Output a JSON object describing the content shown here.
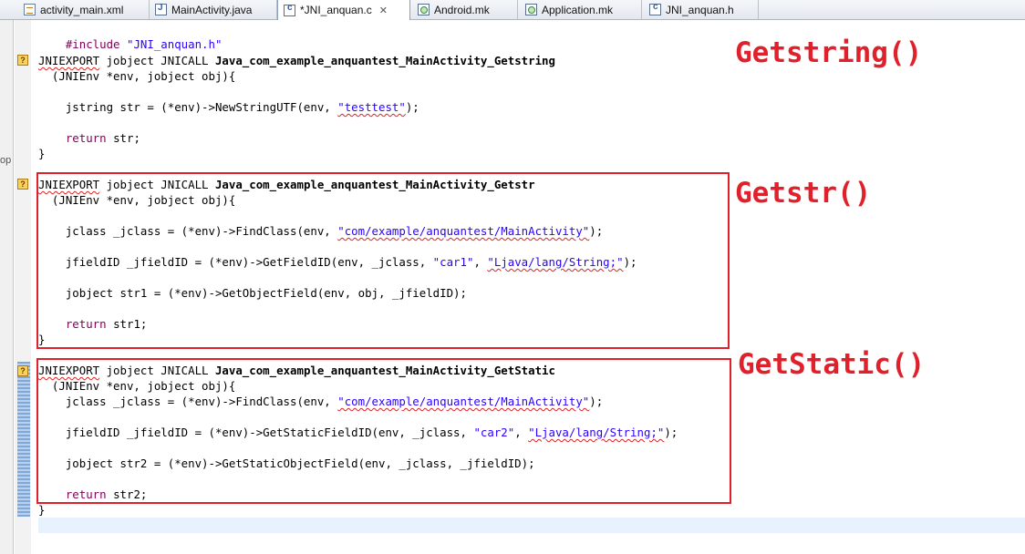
{
  "tabs": [
    {
      "label": "activity_main.xml",
      "icon": "xml-file-icon"
    },
    {
      "label": "MainActivity.java",
      "icon": "java-file-icon"
    },
    {
      "label": "*JNI_anquan.c",
      "icon": "c-file-icon",
      "active": true
    },
    {
      "label": "Android.mk",
      "icon": "mk-file-icon"
    },
    {
      "label": "Application.mk",
      "icon": "mk-file-icon"
    },
    {
      "label": "JNI_anquan.h",
      "icon": "h-file-icon"
    }
  ],
  "tab_close_glyph": "✕",
  "edge_text": "op",
  "warning_glyph": "?",
  "code": {
    "include": {
      "directive": "#include",
      "file": "\"JNI_anquan.h\""
    },
    "f1": {
      "export": "JNIEXPORT",
      "sig_rest": " jobject JNICALL ",
      "name": "Java_com_example_anquantest_MainActivity_Getstring",
      "params": "  (JNIEnv *env, jobject obj){",
      "l1_pre": "    jstring str = (*env)->NewStringUTF(env, ",
      "l1_str": "\"testtest\"",
      "l1_post": ");",
      "ret_kw": "return",
      "ret_rest": " str;",
      "close": "}"
    },
    "f2": {
      "export": "JNIEXPORT",
      "sig_rest": " jobject JNICALL ",
      "name": "Java_com_example_anquantest_MainActivity_Getstr",
      "params": "  (JNIEnv *env, jobject obj){",
      "l1_pre": "    jclass _jclass = (*env)->FindClass(env, ",
      "l1_str": "\"com/example/anquantest/MainActivity\"",
      "l1_post": ");",
      "l2_pre": "    jfieldID _jfieldID = (*env)->GetFieldID(env, _jclass, ",
      "l2_str1": "\"car1\"",
      "l2_mid": ", ",
      "l2_str2": "\"Ljava/lang/String;\"",
      "l2_post": ");",
      "l3": "    jobject str1 = (*env)->GetObjectField(env, obj, _jfieldID);",
      "ret_kw": "return",
      "ret_rest": " str1;",
      "close": "}"
    },
    "f3": {
      "export": "JNIEXPORT",
      "sig_rest": " jobject JNICALL ",
      "name": "Java_com_example_anquantest_MainActivity_GetStatic",
      "params": "  (JNIEnv *env, jobject obj){",
      "l1_pre": "    jclass _jclass = (*env)->FindClass(env, ",
      "l1_str": "\"com/example/anquantest/MainActivity\"",
      "l1_post": ");",
      "l2_pre": "    jfieldID _jfieldID = (*env)->GetStaticFieldID(env, _jclass, ",
      "l2_str1": "\"car2\"",
      "l2_mid": ", ",
      "l2_str2": "\"Ljava/lang/String;\"",
      "l2_post": ");",
      "l3": "    jobject str2 = (*env)->GetStaticObjectField(env, _jclass, _jfieldID);",
      "ret_kw": "return",
      "ret_rest": " str2;",
      "close": "}"
    }
  },
  "annotations": {
    "getstring": "Getstring()",
    "getstr": "Getstr()",
    "getstatic": "GetStatic()"
  },
  "colors": {
    "annotation_red": "#e0202a",
    "keyword": "#7f0055",
    "string": "#2a00ff"
  }
}
